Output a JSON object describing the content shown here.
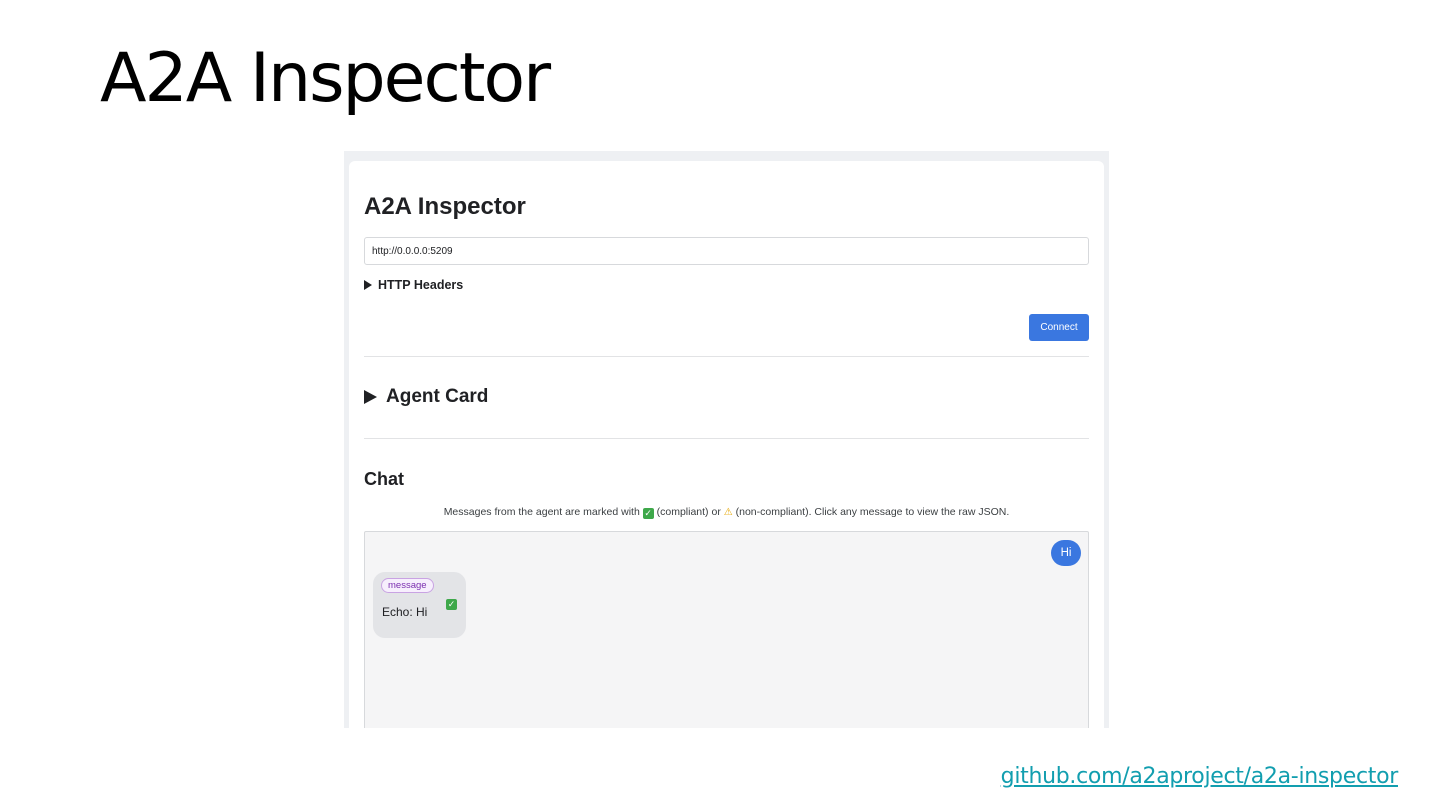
{
  "slide": {
    "title": "A2A Inspector",
    "link": "github.com/a2aproject/a2a-inspector"
  },
  "app": {
    "title": "A2A Inspector",
    "url_value": "http://0.0.0.0:5209",
    "http_headers_label": "HTTP Headers",
    "connect_label": "Connect",
    "agent_card_label": "Agent Card",
    "chat_title": "Chat",
    "chat_hint": {
      "prefix": "Messages from the agent are marked with",
      "compliant": "(compliant) or",
      "noncompliant": "(non-compliant). Click any message to view the raw JSON."
    },
    "messages": {
      "user_text": "Hi",
      "agent_kind": "message",
      "agent_text": "Echo: Hi"
    }
  },
  "icons": {
    "compliant": "check-mark-icon",
    "noncompliant": "warning-icon",
    "expand": "triangle-right-icon"
  },
  "colors": {
    "accent": "#3a77e0",
    "link": "#129eaf",
    "compliant": "#3ea84a",
    "warning": "#e6a700",
    "badge": "#7b2fb0"
  }
}
